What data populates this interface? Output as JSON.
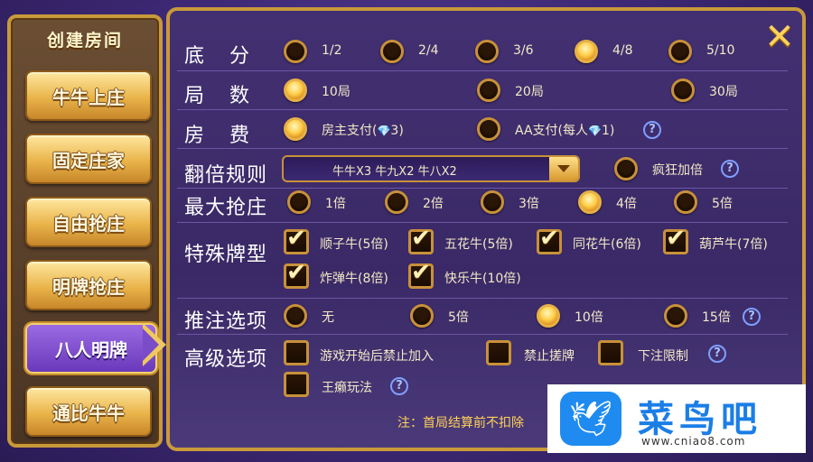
{
  "left_panel": {
    "title": "创建房间",
    "modes": [
      "牛牛上庄",
      "固定庄家",
      "自由抢庄",
      "明牌抢庄",
      "八人明牌",
      "通比牛牛"
    ],
    "active_mode": "八人明牌"
  },
  "close_icon": "close-icon",
  "rows": {
    "base_score": {
      "label": "底分",
      "options": [
        "1/2",
        "2/4",
        "3/6",
        "4/8",
        "5/10"
      ],
      "selected": "4/8"
    },
    "rounds": {
      "label": "局数",
      "options": [
        "10局",
        "20局",
        "30局"
      ],
      "selected": "10局"
    },
    "room_fee": {
      "label": "房费",
      "opt1_prefix": "房主支付(",
      "opt1_value": "3)",
      "opt2_prefix": "AA支付(每人",
      "opt2_value": "1)",
      "selected": "房主支付"
    },
    "multiplier": {
      "label": "翻倍规则",
      "dropdown_value": "牛牛X3  牛九X2  牛八X2",
      "crazy_label": "疯狂加倍",
      "crazy_checked": false
    },
    "max_grab": {
      "label": "最大抢庄",
      "options": [
        "1倍",
        "2倍",
        "3倍",
        "4倍",
        "5倍"
      ],
      "selected": "4倍"
    },
    "special": {
      "label": "特殊牌型",
      "options": [
        "顺子牛(5倍)",
        "五花牛(5倍)",
        "同花牛(6倍)",
        "葫芦牛(7倍)",
        "炸弹牛(8倍)",
        "快乐牛(10倍)"
      ]
    },
    "push_bet": {
      "label": "推注选项",
      "options": [
        "无",
        "5倍",
        "10倍",
        "15倍"
      ],
      "selected": "10倍"
    },
    "advanced": {
      "label": "高级选项",
      "options": [
        "游戏开始后禁止加入",
        "禁止搓牌",
        "下注限制",
        "王癞玩法"
      ]
    }
  },
  "help_symbol": "?",
  "note": "注：首局结算前不扣除",
  "watermark": {
    "title": "菜鸟吧",
    "url": "www.cniao8.com",
    "logo_icon": "bird-icon"
  },
  "colors": {
    "accent": "#c8913a",
    "panel": "#3a2966",
    "note": "#ffd257"
  }
}
